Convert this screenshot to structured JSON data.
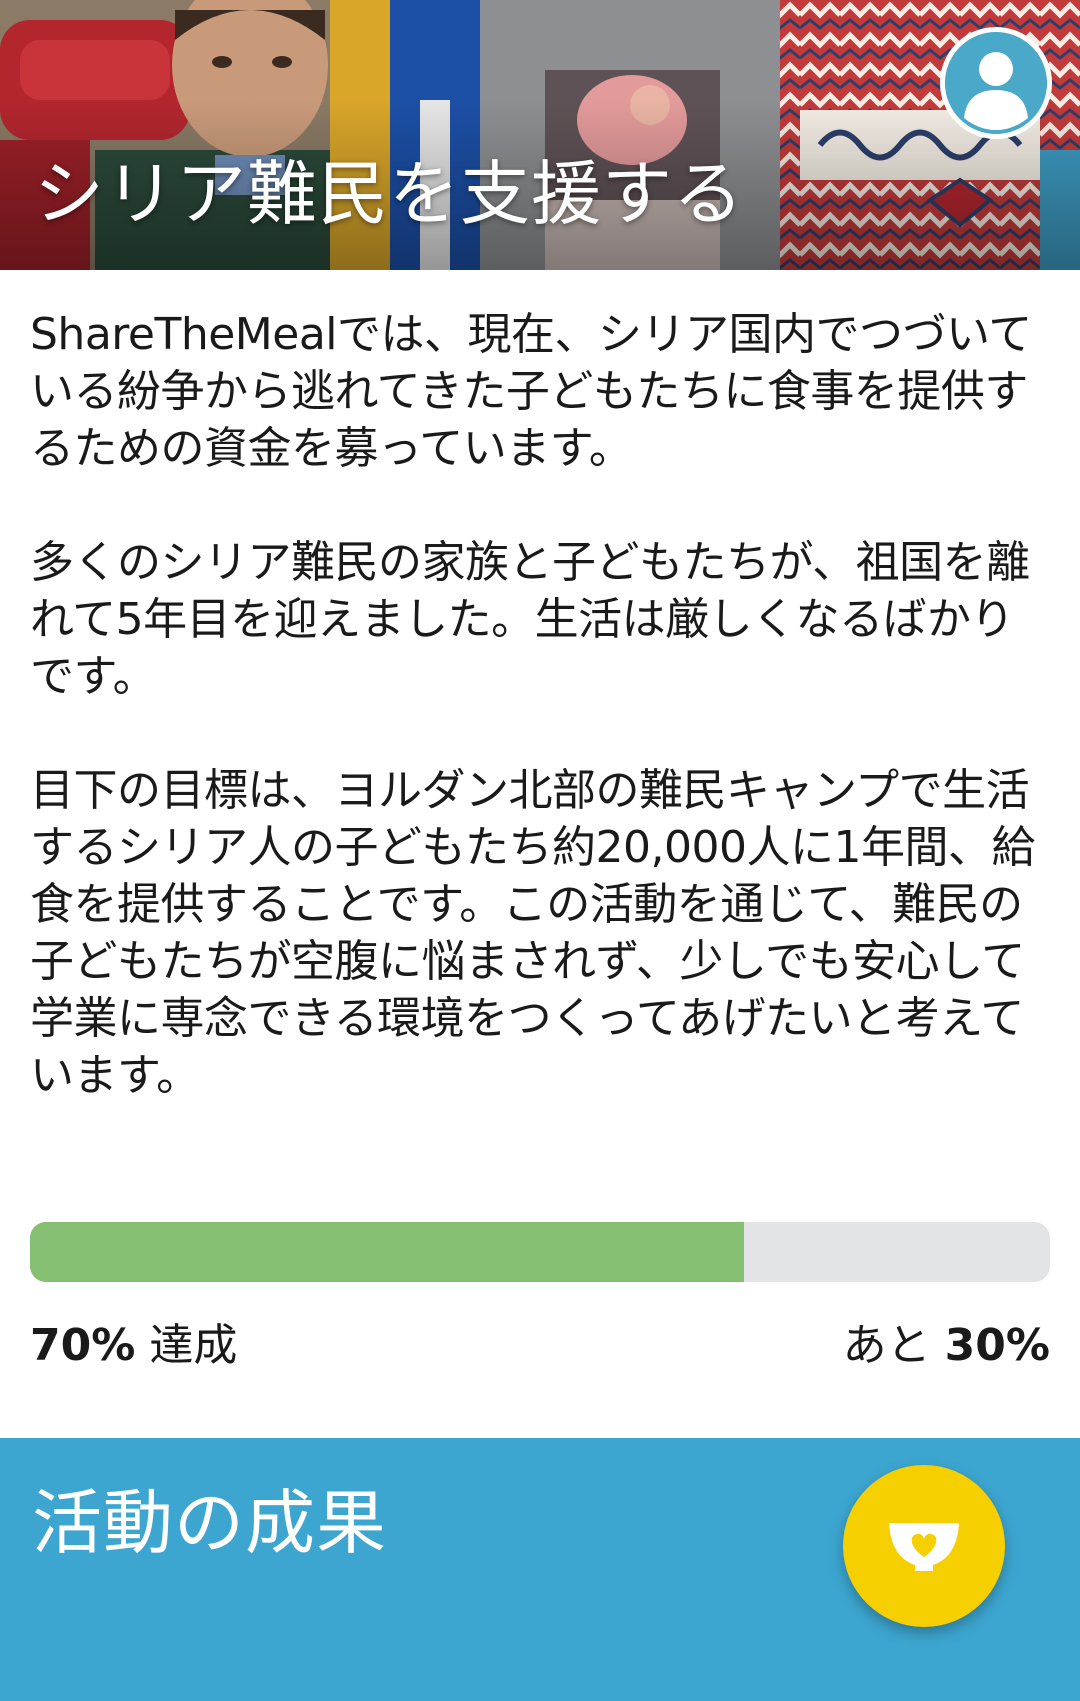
{
  "hero": {
    "title": "シリア難民を支援する"
  },
  "description": {
    "paragraphs": [
      "ShareTheMealでは、現在、シリア国内でつづいている紛争から逃れてきた子どもたちに食事を提供するための資金を募っています。",
      "多くのシリア難民の家族と子どもたちが、祖国を離れて5年目を迎えました。生活は厳しくなるばかりです。",
      "目下の目標は、ヨルダン北部の難民キャンプで生活するシリア人の子どもたち約20,000人に1年間、給食を提供することです。この活動を通じて、難民の子どもたちが空腹に悩まされず、少しでも安心して学業に専念できる環境をつくってあげたいと考えています。"
    ]
  },
  "progress": {
    "achieved_percent": 70,
    "achieved_value": "70%",
    "achieved_label": "達成",
    "remaining_prefix": "あと",
    "remaining_value": "30%"
  },
  "results": {
    "title": "活動の成果"
  },
  "icons": {
    "profile": "user-profile-icon",
    "donate": "bowl-heart-icon"
  },
  "colors": {
    "progress_fill": "#85c072",
    "progress_track": "#e2e4e6",
    "results_bg": "#3ca6d0",
    "fab_bg": "#f6cf00"
  }
}
